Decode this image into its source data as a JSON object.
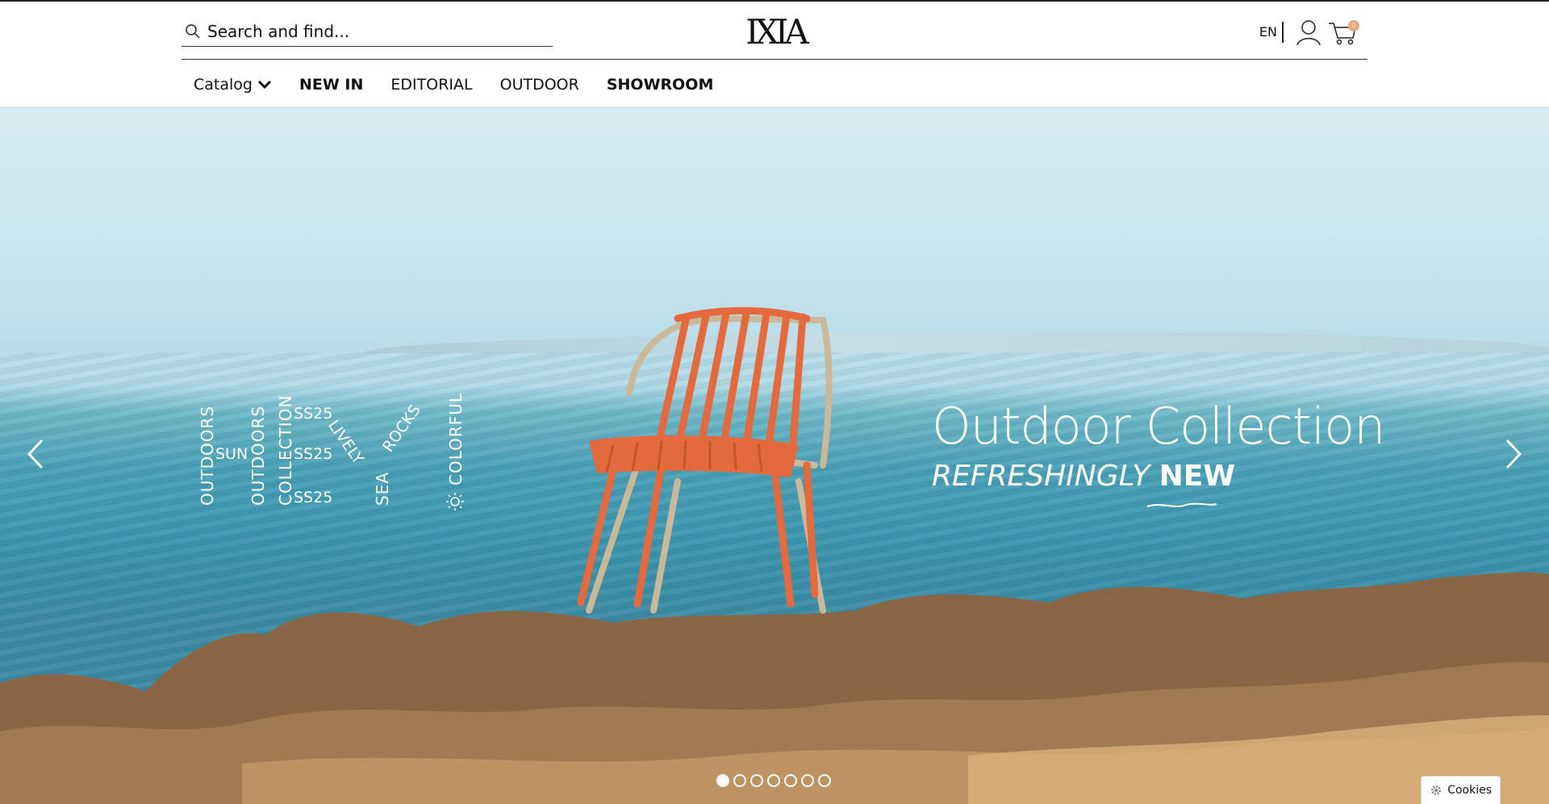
{
  "header": {
    "search": {
      "placeholder": "Search and find..."
    },
    "logo_text": "IXIA",
    "language": "EN",
    "cart_count": "0",
    "icons": [
      "search-icon",
      "user-icon",
      "cart-icon"
    ]
  },
  "nav": {
    "items": [
      {
        "label": "Catalog",
        "bold": false,
        "has_dropdown": true
      },
      {
        "label": "NEW IN",
        "bold": true
      },
      {
        "label": "EDITORIAL",
        "bold": false
      },
      {
        "label": "OUTDOOR",
        "bold": false
      },
      {
        "label": "SHOWROOM",
        "bold": true
      }
    ]
  },
  "hero": {
    "headline": "Outdoor Collection",
    "sub_italic": "REFRESHINGLY",
    "sub_bold": "NEW",
    "words": {
      "outdoors1": "OUTDOORS",
      "sun": "SUN",
      "outdoors2": "OUTDOORS",
      "collection": "COLLECTION",
      "ss25a": "SS25",
      "ss25b": "SS25",
      "ss25c": "SS25",
      "lively": "LIVELY",
      "rocks": "ROCKS",
      "sea": "SEA",
      "colorful": "COLORFUL"
    },
    "slide_count": 7,
    "active_slide": 1
  },
  "cookies": {
    "label": "Cookies"
  },
  "colors": {
    "badge": "#e9a77b",
    "chair_front": "#e4693c",
    "chair_back": "#c9b89a"
  }
}
